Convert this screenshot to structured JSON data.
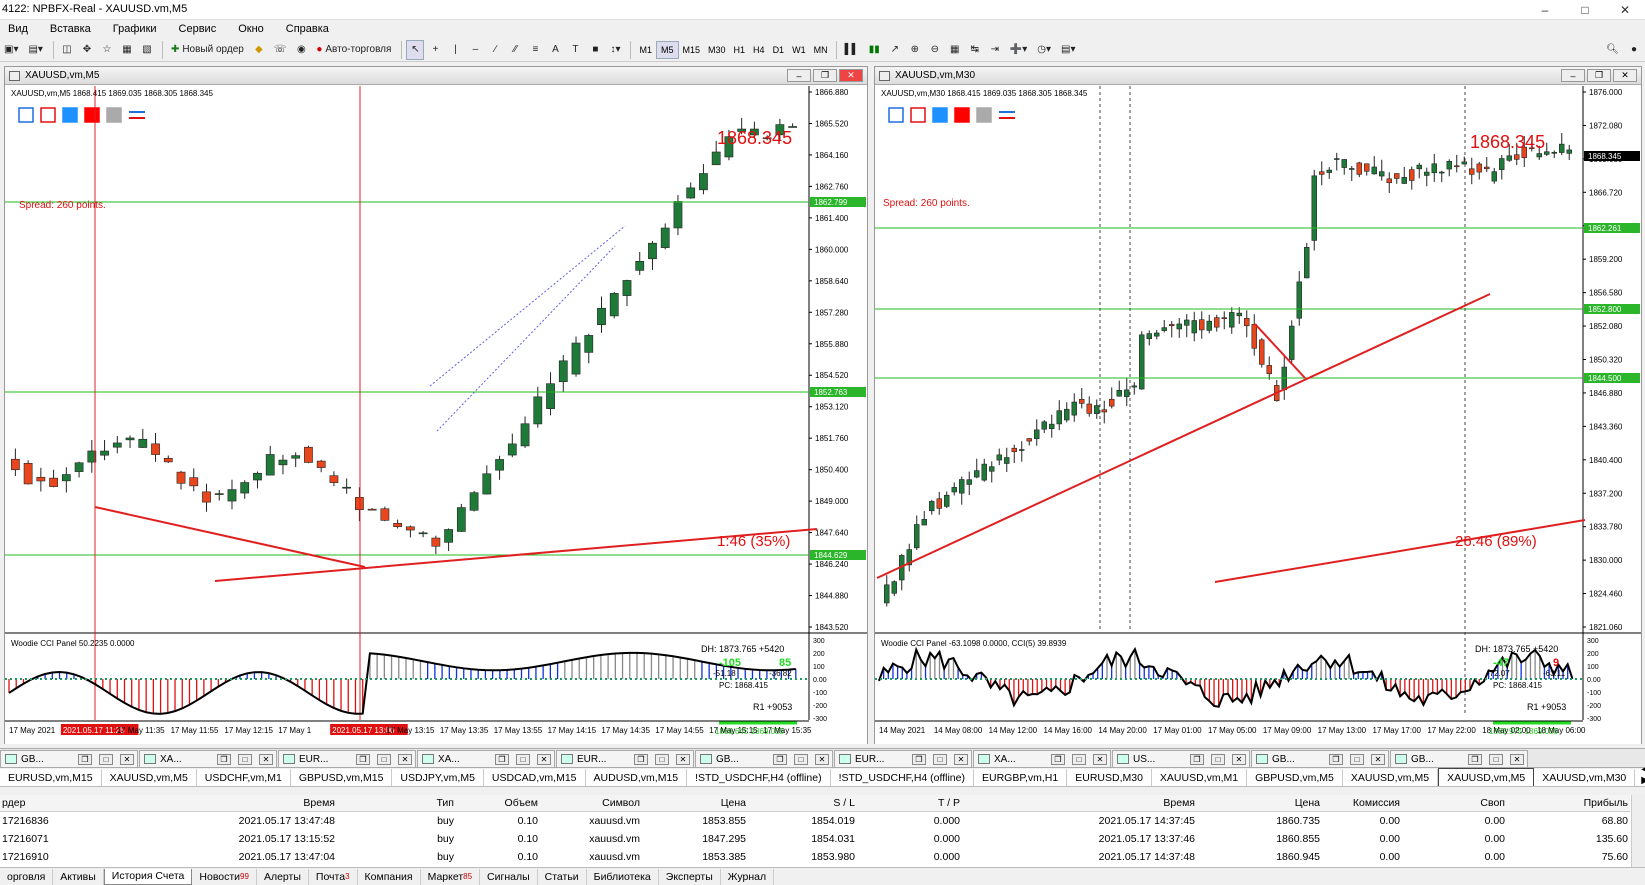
{
  "app": {
    "title": "4122: NPBFX-Real - XAUUSD.vm,M5"
  },
  "menu": [
    "Вид",
    "Вставка",
    "Графики",
    "Сервис",
    "Окно",
    "Справка"
  ],
  "toolbar": {
    "new_order": "Новый ордер",
    "auto_trading": "Авто-торговля",
    "timeframes": [
      "M1",
      "M5",
      "M15",
      "M30",
      "H1",
      "H4",
      "D1",
      "W1",
      "MN"
    ],
    "active_timeframe": "M5"
  },
  "left_chart": {
    "window_title": "XAUUSD,vm,M5",
    "info": "XAUUSD,vm,M5  1868.415 1869.035 1868.305 1868.345",
    "price_big": "1868.345",
    "spread": "Spread: 260 points.",
    "timer": "1:46 (35%)",
    "price_labels": [
      "1866.880",
      "1865.520",
      "1864.160",
      "1862.760",
      "1861.400",
      "1860.000",
      "1858.640",
      "1857.280",
      "1855.880",
      "1854.520",
      "1853.120",
      "1851.760",
      "1850.400",
      "1849.000",
      "1847.640",
      "1846.240",
      "1844.880",
      "1843.520"
    ],
    "line_labels": [
      "1862.799",
      "1852.763",
      "1844.629"
    ],
    "panel_title": "Woodie CCI Panel 50.2235 0.0000",
    "dh": "DH: 1873.765 +5420",
    "cci_vals": [
      "-105",
      "85",
      "-51.18",
      "-36.82"
    ],
    "pc": "PC: 1868.415",
    "r1": "R1 +9053",
    "bid_ask": "1868.645  1869.035",
    "ind_scale": [
      "300",
      "200",
      "100",
      "0.00",
      "-100",
      "-200",
      "-300"
    ],
    "time_labels": [
      "17 May 2021",
      "2021.05.17 11:25",
      "17 May 11:35",
      "17 May 11:55",
      "17 May 12:15",
      "17 May 1",
      "2021.05.17 13:00",
      "17 May 13:15",
      "17 May 13:35",
      "17 May 13:55",
      "17 May 14:15",
      "17 May 14:35",
      "17 May 14:55",
      "17 May 15:15",
      "17 May 15:35"
    ]
  },
  "right_chart": {
    "window_title": "XAUUSD,vm,M30",
    "info": "XAUUSD,vm,M30  1868.415 1869.035 1868.305 1868.345",
    "price_big": "1868.345",
    "spread": "Spread: 260 points.",
    "timer": "26:46 (89%)",
    "price_labels": [
      "1876.000",
      "1872.080",
      "1869.080",
      "1866.720",
      "1863.040",
      "1859.200",
      "1856.580",
      "1852.080",
      "1850.320",
      "1846.880",
      "1843.360",
      "1840.400",
      "1837.200",
      "1833.780",
      "1830.000",
      "1824.460",
      "1821.060"
    ],
    "line_labels": [
      "1868.345",
      "1862.261",
      "1852.800",
      "1844.500"
    ],
    "panel_title": "Woodie CCI Panel -63.1098 0.0000, CCI(5) 39.8939",
    "dh": "DH: 1873.765 +5420",
    "cci_vals": [
      "-47",
      "9",
      "-72.07",
      "-63.11"
    ],
    "pc": "PC: 1868.415",
    "r1": "R1 +9053",
    "bid_ask": "1868.975  1869.035",
    "ind_scale": [
      "300",
      "200",
      "100",
      "0.00",
      "-100",
      "-200",
      "-300"
    ],
    "time_labels": [
      "14 May 2021",
      "14 May 08:00",
      "14 May 12:00",
      "14 May 16:00",
      "14 May 20:00",
      "17 May 01:00",
      "17 May 05:00",
      "17 May 09:00",
      "17 May 13:00",
      "17 May 17:00",
      "17 May 22:00",
      "18 May 02:00",
      "18 May 06:00"
    ]
  },
  "window_tabs": [
    "GB...",
    "XA...",
    "EUR...",
    "XA...",
    "EUR...",
    "GB...",
    "EUR...",
    "XA...",
    "US...",
    "GB...",
    "GB..."
  ],
  "symbol_tabs": [
    "EURUSD,vm,M15",
    "XAUUSD,vm,M5",
    "USDCHF,vm,M1",
    "GBPUSD,vm,M15",
    "USDJPY,vm,M5",
    "USDCAD,vm,M15",
    "AUDUSD,vm,M15",
    "!STD_USDCHF,H4 (offline)",
    "!STD_USDCHF,H4 (offline)",
    "EURGBP,vm,H1",
    "EURUSD,M30",
    "XAUUSD,vm,M1",
    "GBPUSD,vm,M5",
    "XAUUSD,vm,M5",
    "XAUUSD,vm,M5",
    "XAUUSD,vm,M30"
  ],
  "active_symbol_tab": 14,
  "terminal": {
    "headers": [
      "рдер",
      "Время",
      "Тип",
      "Объем",
      "Символ",
      "Цена",
      "S / L",
      "T / P",
      "Время",
      "Цена",
      "Комиссия",
      "Своп",
      "Прибыль"
    ],
    "rows": [
      [
        "17216836",
        "2021.05.17 13:47:48",
        "buy",
        "0.10",
        "xauusd.vm",
        "1853.855",
        "1854.019",
        "0.000",
        "2021.05.17 14:37:45",
        "1860.735",
        "0.00",
        "0.00",
        "68.80"
      ],
      [
        "17216071",
        "2021.05.17 13:15:52",
        "buy",
        "0.10",
        "xauusd.vm",
        "1847.295",
        "1854.031",
        "0.000",
        "2021.05.17 13:37:46",
        "1860.855",
        "0.00",
        "0.00",
        "135.60"
      ],
      [
        "17216910",
        "2021.05.17 13:47:04",
        "buy",
        "0.10",
        "xauusd.vm",
        "1853.385",
        "1853.980",
        "0.000",
        "2021.05.17 14:37:48",
        "1860.945",
        "0.00",
        "0.00",
        "75.60"
      ]
    ]
  },
  "bottom_tabs": [
    {
      "label": "орговля",
      "badge": ""
    },
    {
      "label": "Активы",
      "badge": ""
    },
    {
      "label": "История Счета",
      "badge": ""
    },
    {
      "label": "Новости",
      "badge": "99"
    },
    {
      "label": "Алерты",
      "badge": ""
    },
    {
      "label": "Почта",
      "badge": "3"
    },
    {
      "label": "Компания",
      "badge": ""
    },
    {
      "label": "Маркет",
      "badge": "85"
    },
    {
      "label": "Сигналы",
      "badge": ""
    },
    {
      "label": "Статьи",
      "badge": ""
    },
    {
      "label": "Библиотека",
      "badge": ""
    },
    {
      "label": "Эксперты",
      "badge": ""
    },
    {
      "label": "Журнал",
      "badge": ""
    }
  ],
  "active_bottom_tab": 2,
  "colors": {
    "bull": "#1f7a3a",
    "bear": "#e8461d",
    "level_line": "#22bb22",
    "trend": "#e02020",
    "cci_blue": "#1030e0",
    "cci_red": "#e01010",
    "cci_gray": "#888888"
  }
}
